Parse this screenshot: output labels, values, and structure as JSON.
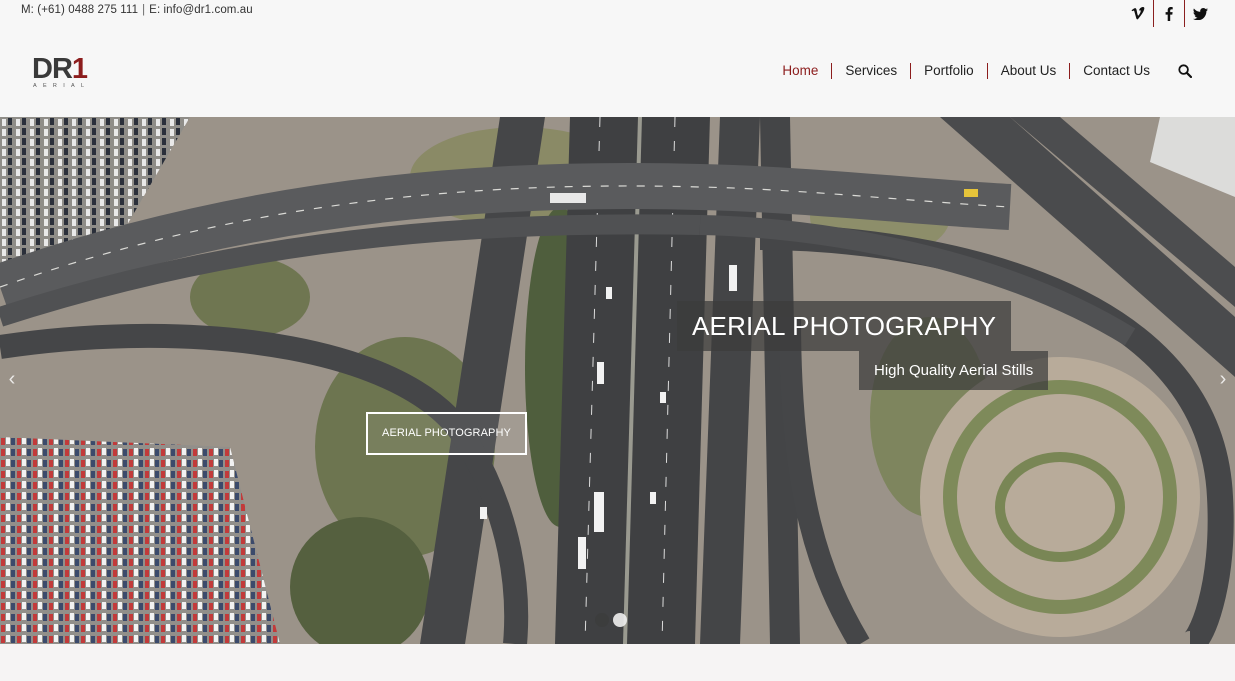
{
  "topbar": {
    "phone": "M: (+61) 0488 275 111",
    "separator": "|",
    "email": "E: info@dr1.com.au",
    "social": [
      {
        "name": "vimeo-icon",
        "glyph": "v"
      },
      {
        "name": "facebook-icon",
        "glyph": "f"
      },
      {
        "name": "twitter-icon",
        "glyph": "t"
      }
    ]
  },
  "brand": {
    "logo_main": "DR",
    "logo_accent": "1",
    "logo_sub": "AERIAL"
  },
  "nav": {
    "items": [
      {
        "label": "Home",
        "active": true
      },
      {
        "label": "Services",
        "active": false
      },
      {
        "label": "Portfolio",
        "active": false
      },
      {
        "label": "About Us",
        "active": false
      },
      {
        "label": "Contact Us",
        "active": false
      }
    ],
    "search_icon": "search-icon"
  },
  "slider": {
    "title": "AERIAL PHOTOGRAPHY",
    "subtitle": "High Quality Aerial Stills",
    "button_label": "AERIAL PHOTOGRAPHY",
    "prev_glyph": "‹",
    "next_glyph": "›",
    "slide_count": 2,
    "active_slide": 2
  },
  "colors": {
    "accent": "#8c1d1d",
    "text": "#222222",
    "background": "#f7f7f7"
  }
}
